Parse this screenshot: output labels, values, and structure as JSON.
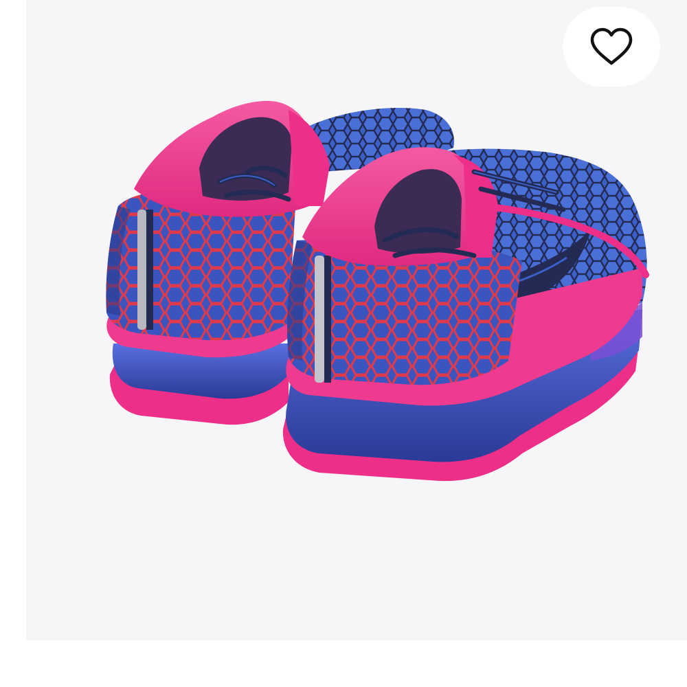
{
  "product_image": {
    "alt": "",
    "colors": {
      "background": "#f6f6f8",
      "upper_blue": "#3c5fc8",
      "navy": "#232b55",
      "pink": "#ee2f8a",
      "light_pink": "#f26aa8",
      "red_pattern": "#e23a4a",
      "sole_blue": "#3d4fb8",
      "reflective_strip": "#b8b8c0"
    }
  },
  "favorite_button": {
    "icon": "heart-outline-icon",
    "state": "not-favorited"
  }
}
